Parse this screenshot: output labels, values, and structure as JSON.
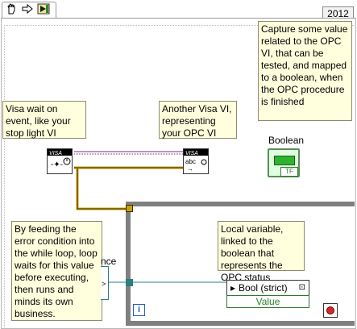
{
  "toolbar": {
    "version": "2012",
    "icons": [
      "hand-icon",
      "arrow-icon",
      "run-icon"
    ]
  },
  "notes": {
    "capture": "Capture some value related to the OPC VI, that can be tested, and mapped to a boolean, when the OPC procedure is finished",
    "visa_wait": "Visa wait on event, like your stop light VI",
    "another_visa": "Another Visa VI, representing your OPC VI",
    "feeding": "By feeding the error condition into the while loop, loop waits for this value before executing, then runs and minds its own business.",
    "local_variable": "Local variable, linked to the boolean that represents the OPC status"
  },
  "boolean_label": "Boolean",
  "boolean_text": "TF",
  "sequence_fragment": "nce",
  "local_var_text": "Bool (strict)",
  "value_label": "Value",
  "iteration": "i",
  "colors": {
    "note_bg": "#ffffdd",
    "loop_border": "#808080",
    "wire_error": "#c9a200",
    "wire_ref": "#7a2a7a",
    "wire_bool": "#2a7f7f"
  }
}
